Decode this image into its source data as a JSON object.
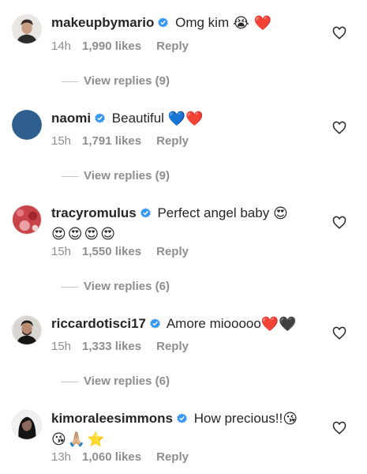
{
  "comments": [
    {
      "username": "makeupbymario",
      "text": "Omg kim",
      "emojis": "😭 ❤️",
      "emojis2": "",
      "time": "14h",
      "likes": "1,990 likes",
      "reply": "Reply",
      "view_replies": "View replies (9)",
      "avatar_icon": "man-portrait-avatar"
    },
    {
      "username": "naomi",
      "text": "Beautiful",
      "emojis": "💙❤️",
      "emojis2": "",
      "time": "15h",
      "likes": "1,791 likes",
      "reply": "Reply",
      "view_replies": "View replies (9)",
      "avatar_icon": "blue-circle-avatar"
    },
    {
      "username": "tracyromulus",
      "text": "Perfect angel baby",
      "emojis": "😍",
      "emojis2": "😍😍😍😍",
      "time": "15h",
      "likes": "1,550 likes",
      "reply": "Reply",
      "view_replies": "View replies (6)",
      "avatar_icon": "red-photo-avatar"
    },
    {
      "username": "riccardotisci17",
      "text": "Amore miooooo",
      "emojis": "❤️🖤",
      "emojis2": "",
      "time": "15h",
      "likes": "1,333 likes",
      "reply": "Reply",
      "view_replies": "View replies (6)",
      "avatar_icon": "man-portrait-avatar"
    },
    {
      "username": "kimoraleesimmons",
      "text": "How precious!!",
      "emojis": "😘",
      "emojis2": "😘🙏🏼⭐",
      "time": "13h",
      "likes": "1,060 likes",
      "reply": "Reply",
      "view_replies": "",
      "avatar_icon": "woman-portrait-avatar"
    }
  ],
  "colors": {
    "verified_blue": "#3897f0",
    "meta_gray": "#8e8e8e",
    "text_dark": "#262626"
  }
}
